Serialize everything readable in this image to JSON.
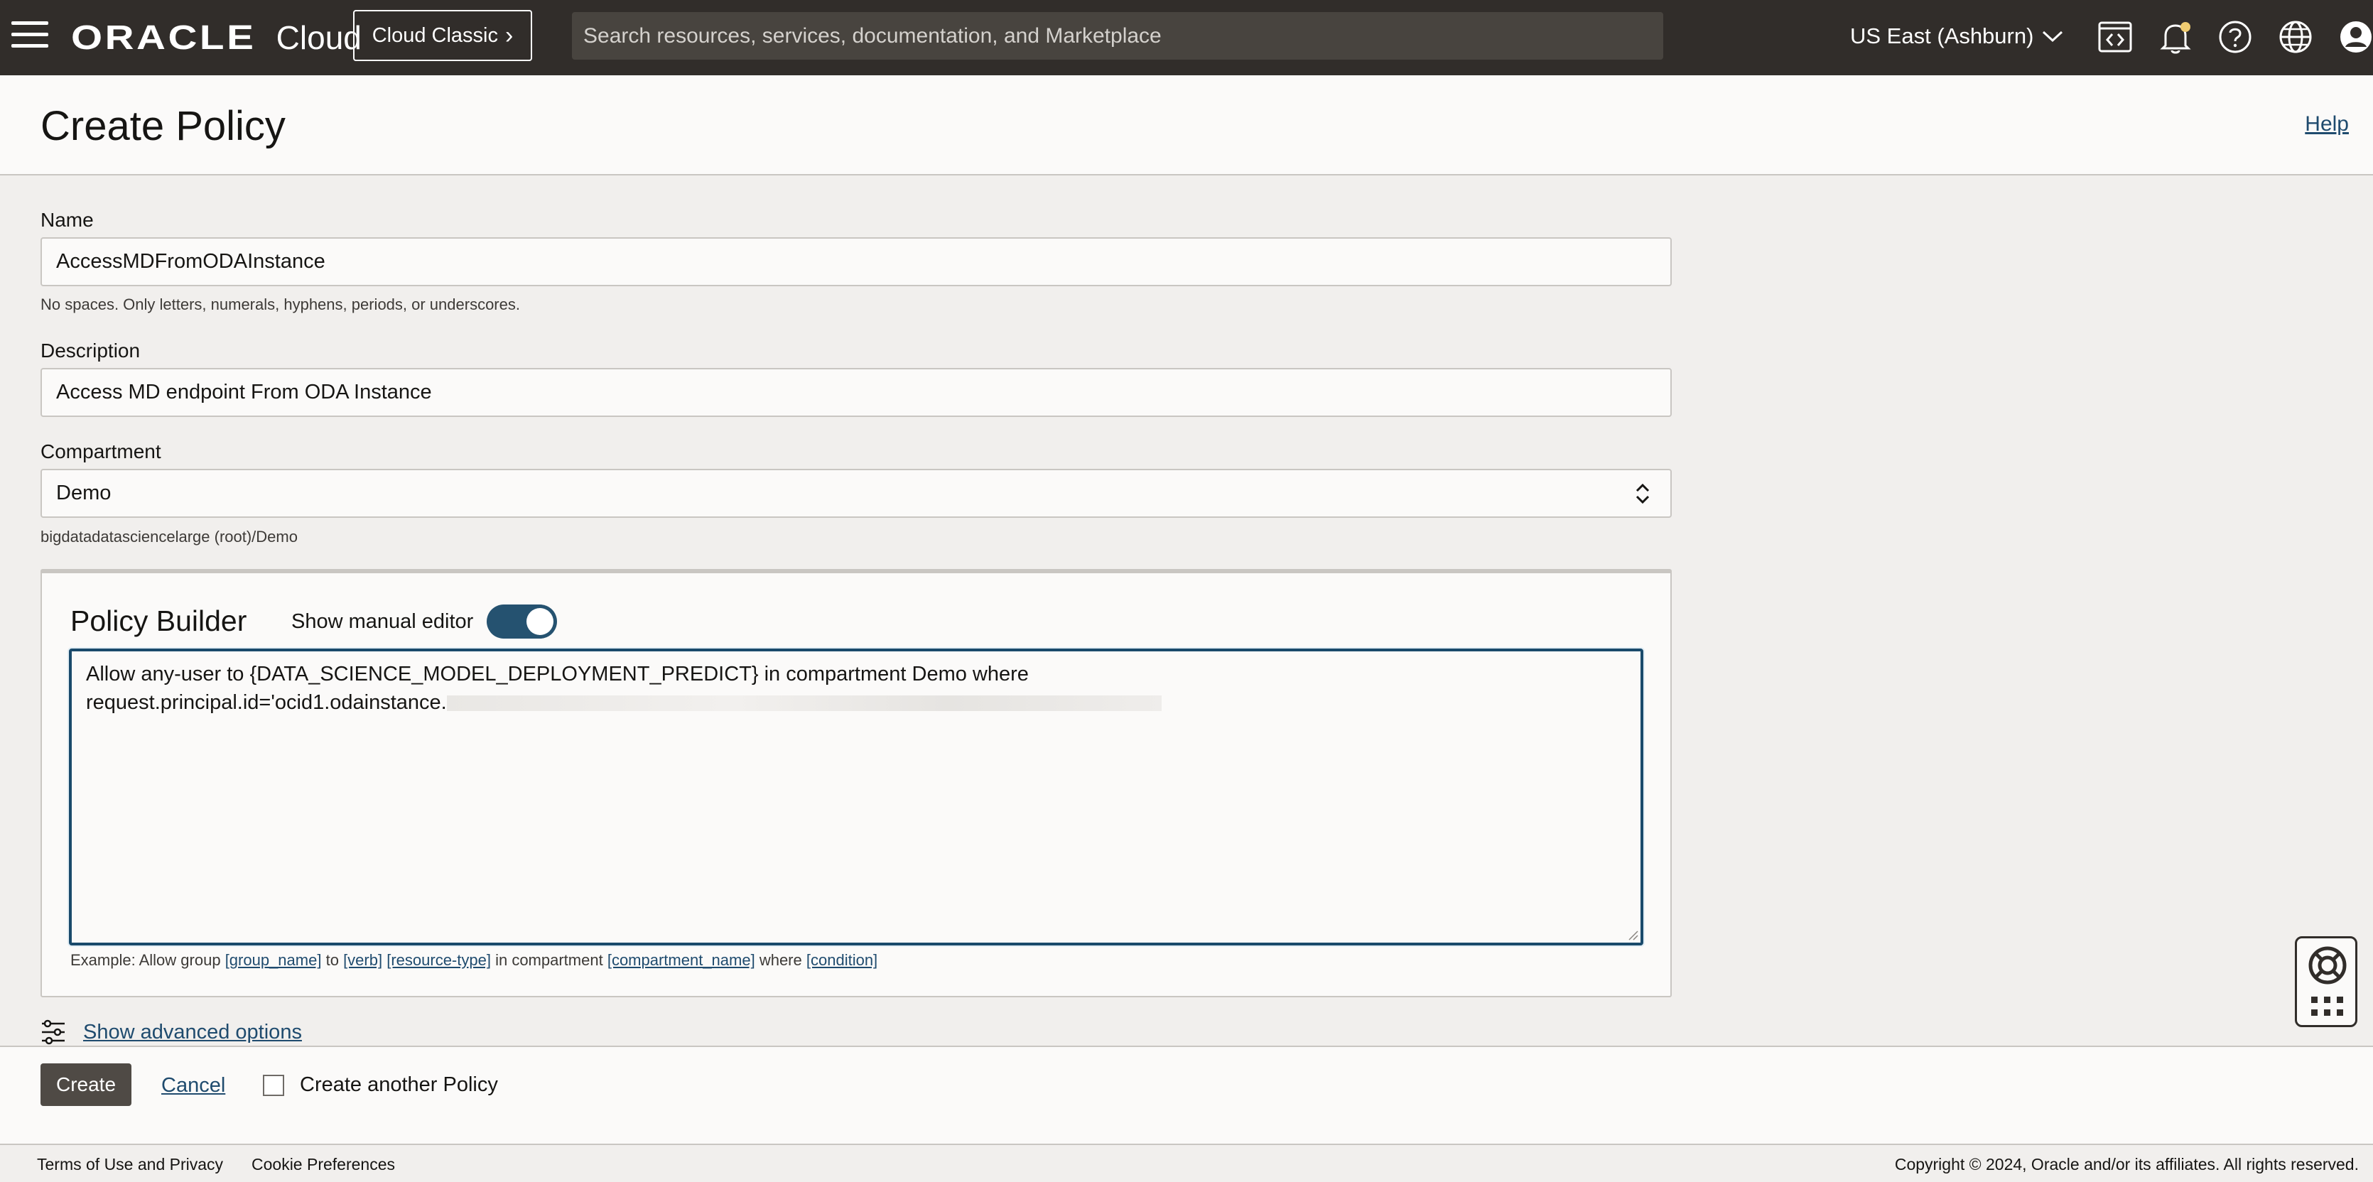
{
  "topbar": {
    "brand": "ORACLE",
    "product": "Cloud",
    "classic_label": "Cloud Classic",
    "search_placeholder": "Search resources, services, documentation, and Marketplace",
    "region": "US East (Ashburn)"
  },
  "header": {
    "title": "Create Policy",
    "help": "Help"
  },
  "form": {
    "name_label": "Name",
    "name_value": "AccessMDFromODAInstance",
    "name_hint": "No spaces. Only letters, numerals, hyphens, periods, or underscores.",
    "description_label": "Description",
    "description_value": "Access MD endpoint From ODA Instance",
    "compartment_label": "Compartment",
    "compartment_value": "Demo",
    "compartment_path": "bigdatadatasciencelarge (root)/Demo"
  },
  "builder": {
    "title": "Policy Builder",
    "manual_editor_label": "Show manual editor",
    "policy_line1": "Allow any-user to {DATA_SCIENCE_MODEL_DEPLOYMENT_PREDICT} in compartment Demo where",
    "policy_line2_prefix": "request.principal.id='ocid1.odainstance.",
    "example_prefix": "Example: Allow group",
    "example_group": "[group_name]",
    "example_to": "to",
    "example_verb": "[verb]",
    "example_resource": "[resource-type]",
    "example_in": "in compartment",
    "example_compartment": "[compartment_name]",
    "example_where": "where",
    "example_condition": "[condition]"
  },
  "advanced": {
    "label": "Show advanced options"
  },
  "actions": {
    "create": "Create",
    "cancel": "Cancel",
    "create_another": "Create another Policy"
  },
  "footer": {
    "terms": "Terms of Use and Privacy",
    "cookies": "Cookie Preferences",
    "copyright": "Copyright © 2024, Oracle and/or its affiliates. All rights reserved."
  }
}
